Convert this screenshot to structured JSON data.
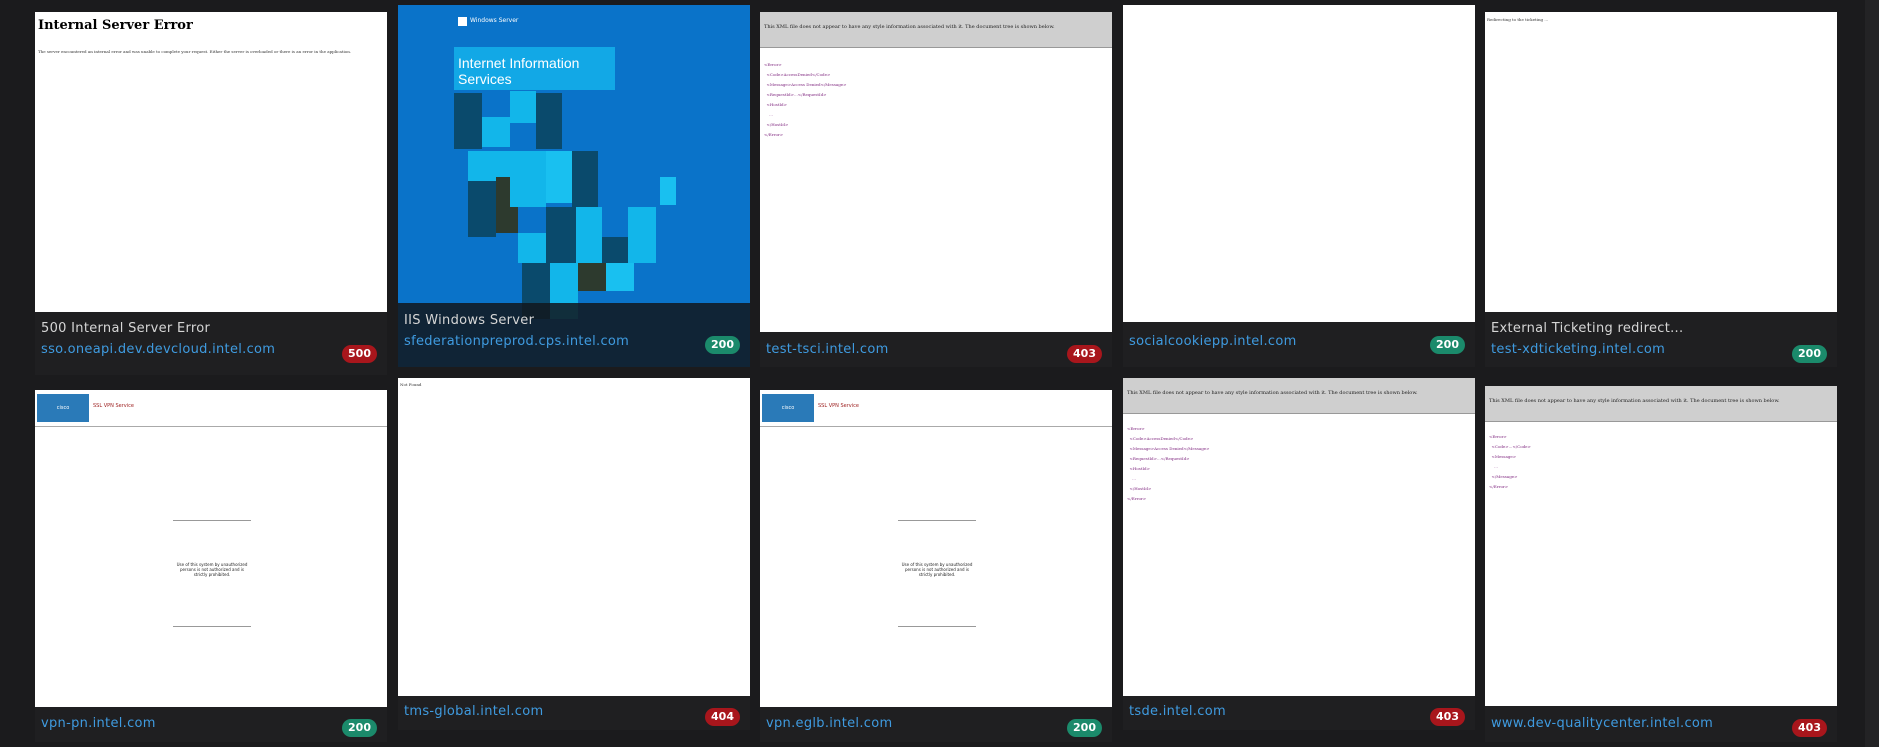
{
  "cards": [
    {
      "title": "500 Internal Server Error",
      "host": "sso.oneapi.dev.devcloud.intel.com",
      "status": "500",
      "shot": {
        "heading": "Internal Server Error",
        "body": "The server encountered an internal error and was unable to complete your request. Either the server is overloaded or there is an error in the application."
      }
    },
    {
      "title": "IIS Windows Server",
      "host": "sfederationpreprod.cps.intel.com",
      "status": "200",
      "shot": {
        "brand": "Windows Server",
        "banner": "Internet Information Services"
      }
    },
    {
      "title": "",
      "host": "test-tsci.intel.com",
      "status": "403",
      "shot": {
        "bar": "This XML file does not appear to have any style information associated with it. The document tree is shown below."
      }
    },
    {
      "title": "",
      "host": "socialcookiepp.intel.com",
      "status": "200"
    },
    {
      "title": "External Ticketing redirect...",
      "host": "test-xdticketing.intel.com",
      "status": "200",
      "shot": {
        "text": "Redirecting to the ticketing ..."
      }
    },
    {
      "title": "",
      "host": "vpn-pn.intel.com",
      "status": "200",
      "shot": {
        "logo": "cisco",
        "header": "SSL VPN Service",
        "msg": "Use of this system by unauthorized persons is not authorized and is strictly prohibited."
      }
    },
    {
      "title": "",
      "host": "tms-global.intel.com",
      "status": "404",
      "shot": {
        "text": "Not Found"
      }
    },
    {
      "title": "",
      "host": "vpn.eglb.intel.com",
      "status": "200",
      "shot": {
        "logo": "cisco",
        "header": "SSL VPN Service",
        "msg": "Use of this system by unauthorized persons is not authorized and is strictly prohibited."
      }
    },
    {
      "title": "",
      "host": "tsde.intel.com",
      "status": "403",
      "shot": {
        "bar": "This XML file does not appear to have any style information associated with it. The document tree is shown below."
      }
    },
    {
      "title": "",
      "host": "www.dev-qualitycenter.intel.com",
      "status": "403",
      "shot": {
        "bar": "This XML file does not appear to have any style information associated with it. The document tree is shown below."
      }
    }
  ]
}
